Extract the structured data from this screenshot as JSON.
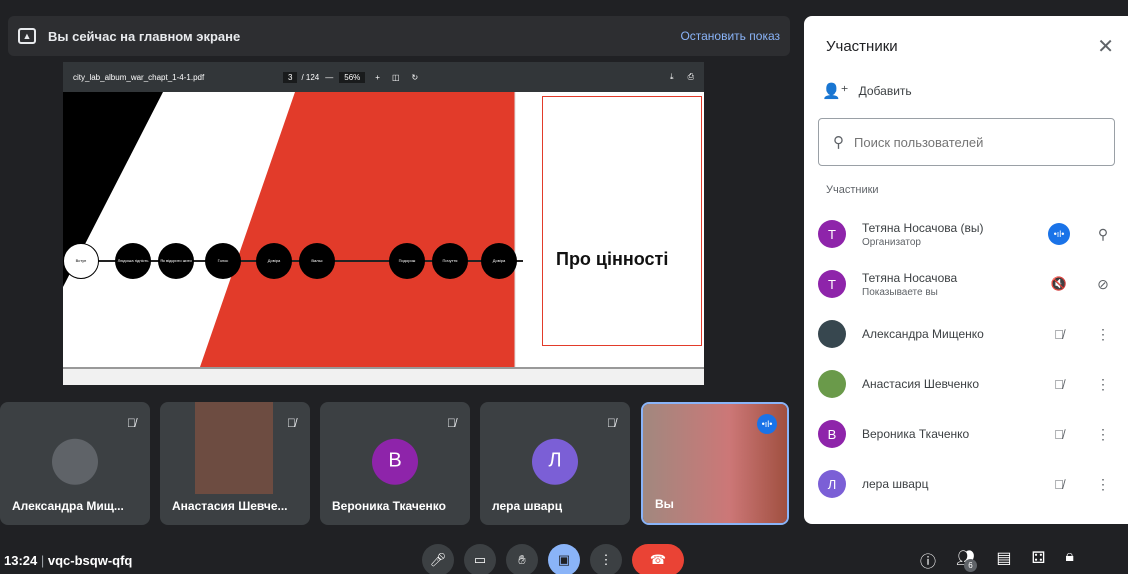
{
  "banner": {
    "title": "Вы сейчас на главном экране",
    "stop_label": "Остановить показ"
  },
  "pdf": {
    "filename": "city_lab_album_war_chapt_1-4-1.pdf",
    "page": "3",
    "total": "/ 124",
    "zoom": "56%"
  },
  "slide": {
    "title": "Про цінності",
    "nodes": [
      "Вступ",
      "Людська гідність",
      "Як відкрито жити",
      "Голос",
      "Довіра",
      "Вальс",
      "Подорож",
      "Почуття",
      "Довіра"
    ]
  },
  "tiles": [
    {
      "name": "Александра Мищ...",
      "initial": "",
      "color": "#5f6368"
    },
    {
      "name": "Анастасия Шевче...",
      "initial": "",
      "color": "#8d6e63"
    },
    {
      "name": "Вероника Ткаченко",
      "initial": "В",
      "color": "#8e24aa"
    },
    {
      "name": "лера шварц",
      "initial": "Л",
      "color": "#7b5fd6"
    },
    {
      "name": "Вы",
      "initial": "",
      "color": "#a1887f"
    }
  ],
  "panel": {
    "title": "Участники",
    "add_label": "Добавить",
    "search_placeholder": "Поиск пользователей",
    "section_label": "Участники",
    "participants": [
      {
        "name": "Тетяна Носачова (вы)",
        "role": "Организатор",
        "initial": "Т",
        "color": "#8e24aa"
      },
      {
        "name": "Тетяна Носачова",
        "role": "Показываете вы",
        "initial": "Т",
        "color": "#8e24aa"
      },
      {
        "name": "Александра Мищенко",
        "role": "",
        "initial": "",
        "color": "#37474f"
      },
      {
        "name": "Анастасия Шевченко",
        "role": "",
        "initial": "",
        "color": "#6a9a4a"
      },
      {
        "name": "Вероника Ткаченко",
        "role": "",
        "initial": "В",
        "color": "#8e24aa"
      },
      {
        "name": "лера шварц",
        "role": "",
        "initial": "Л",
        "color": "#7b5fd6"
      }
    ]
  },
  "bottom": {
    "time": "13:24",
    "meeting_code": "vqc-bsqw-qfq",
    "participants_count": "6"
  }
}
